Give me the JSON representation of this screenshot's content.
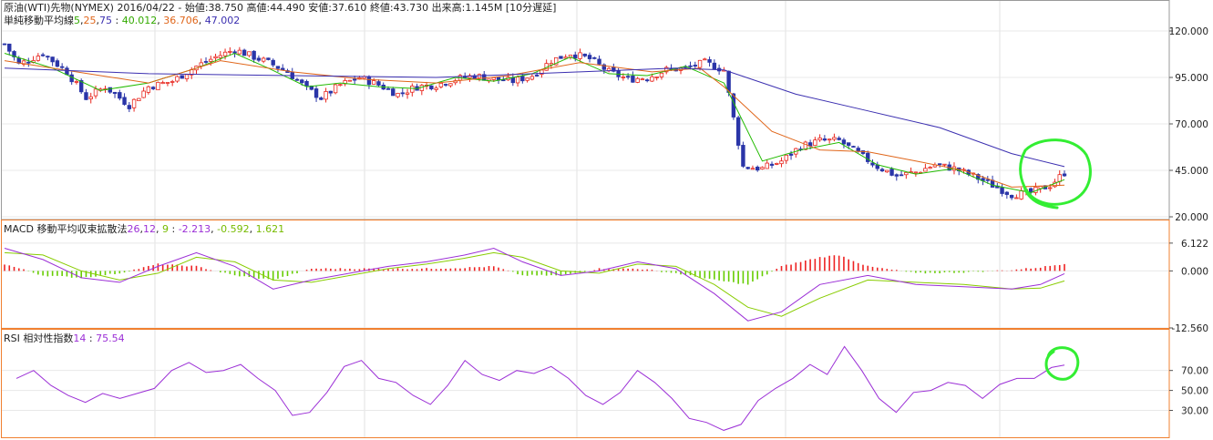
{
  "header": {
    "title": "原油(WTI)先物(NYMEX)",
    "date": "2016/04/22",
    "sep": "-",
    "open": "始値:38.750",
    "high": "高値:44.490",
    "low": "安値:37.610",
    "close": "終値:43.730",
    "volume": "出来高:1.145M",
    "delay": "[10分遅延]"
  },
  "sma_legend": {
    "label": "単純移動平均線",
    "p1": "5",
    "p2": "25",
    "p3": "75",
    "sep": " : ",
    "v1": "40.012",
    "v2": "36.706",
    "v3": "47.002"
  },
  "macd_legend": {
    "label": "MACD 移動平均収束拡散法",
    "p1": "26",
    "p2": "12",
    "p3": "9",
    "sep": " : ",
    "v1": "-2.213",
    "v2": "-0.592",
    "v3": "1.621"
  },
  "rsi_legend": {
    "label": "RSI 相対性指数",
    "period": "14",
    "sep": " : ",
    "value": "75.54"
  },
  "colors": {
    "up": "#e8261e",
    "down": "#2a35a8",
    "sma5": "#22bb00",
    "sma25": "#e0661a",
    "sma75": "#3b2fb0",
    "macd": "#9b2fd6",
    "signal": "#88cc00",
    "hist_pos": "#ee2222",
    "hist_neg": "#66cc00",
    "rsi": "#9b2fd6",
    "annotation": "#33ee33",
    "panel_border": "#f08030"
  },
  "chart_data": [
    {
      "type": "candlestick",
      "name": "price",
      "y_ticks": [
        "120.000",
        "95.000",
        "70.000",
        "45.000",
        "20.000"
      ],
      "ylim": [
        20,
        120
      ],
      "y_tick_values": [
        120,
        95,
        70,
        45,
        20
      ],
      "close_path": [
        [
          0,
          113
        ],
        [
          3,
          102
        ],
        [
          8,
          108
        ],
        [
          13,
          98
        ],
        [
          17,
          84
        ],
        [
          21,
          90
        ],
        [
          26,
          80
        ],
        [
          30,
          90
        ],
        [
          35,
          93
        ],
        [
          40,
          101
        ],
        [
          44,
          106
        ],
        [
          48,
          110
        ],
        [
          52,
          106
        ],
        [
          55,
          103
        ],
        [
          59,
          98
        ],
        [
          63,
          89
        ],
        [
          66,
          84
        ],
        [
          70,
          91
        ],
        [
          74,
          95
        ],
        [
          78,
          91
        ],
        [
          82,
          86
        ],
        [
          86,
          90
        ],
        [
          90,
          91
        ],
        [
          94,
          94
        ],
        [
          98,
          96
        ],
        [
          102,
          94
        ],
        [
          106,
          93
        ],
        [
          110,
          96
        ],
        [
          114,
          104
        ],
        [
          118,
          108
        ],
        [
          122,
          105
        ],
        [
          126,
          98
        ],
        [
          130,
          94
        ],
        [
          134,
          95
        ],
        [
          138,
          99
        ],
        [
          142,
          100
        ],
        [
          146,
          103
        ],
        [
          150,
          99
        ],
        [
          154,
          47
        ],
        [
          158,
          46
        ],
        [
          162,
          50
        ],
        [
          166,
          58
        ],
        [
          170,
          61
        ],
        [
          174,
          61
        ],
        [
          178,
          54
        ],
        [
          182,
          47
        ],
        [
          186,
          42
        ],
        [
          190,
          44
        ],
        [
          194,
          48
        ],
        [
          198,
          46
        ],
        [
          202,
          42
        ],
        [
          206,
          37
        ],
        [
          210,
          32
        ],
        [
          214,
          33
        ],
        [
          218,
          37
        ],
        [
          221,
          43.7
        ]
      ],
      "sma_paths": {
        "sma5": [
          [
            0,
            108
          ],
          [
            10,
            100
          ],
          [
            20,
            88
          ],
          [
            30,
            92
          ],
          [
            40,
            100
          ],
          [
            48,
            108
          ],
          [
            55,
            100
          ],
          [
            63,
            90
          ],
          [
            70,
            92
          ],
          [
            78,
            90
          ],
          [
            86,
            89
          ],
          [
            94,
            95
          ],
          [
            102,
            93
          ],
          [
            110,
            97
          ],
          [
            118,
            106
          ],
          [
            126,
            97
          ],
          [
            134,
            96
          ],
          [
            142,
            101
          ],
          [
            150,
            92
          ],
          [
            158,
            50
          ],
          [
            166,
            56
          ],
          [
            174,
            60
          ],
          [
            182,
            48
          ],
          [
            190,
            43
          ],
          [
            198,
            46
          ],
          [
            206,
            37
          ],
          [
            214,
            33
          ],
          [
            221,
            40
          ]
        ],
        "sma25": [
          [
            0,
            104
          ],
          [
            15,
            98
          ],
          [
            30,
            92
          ],
          [
            45,
            104
          ],
          [
            60,
            98
          ],
          [
            75,
            94
          ],
          [
            90,
            92
          ],
          [
            105,
            96
          ],
          [
            120,
            103
          ],
          [
            135,
            98
          ],
          [
            145,
            100
          ],
          [
            150,
            90
          ],
          [
            160,
            66
          ],
          [
            170,
            56
          ],
          [
            180,
            55
          ],
          [
            190,
            50
          ],
          [
            200,
            45
          ],
          [
            210,
            36
          ],
          [
            221,
            37
          ]
        ],
        "sma75": [
          [
            0,
            100
          ],
          [
            30,
            97
          ],
          [
            60,
            96
          ],
          [
            90,
            95
          ],
          [
            120,
            98
          ],
          [
            140,
            100
          ],
          [
            150,
            99
          ],
          [
            165,
            86
          ],
          [
            180,
            77
          ],
          [
            195,
            68
          ],
          [
            210,
            54
          ],
          [
            221,
            47
          ]
        ]
      }
    },
    {
      "type": "macd",
      "y_ticks": [
        "6.122",
        "0.000",
        "-12.560"
      ],
      "ylim": [
        -12.56,
        7.5
      ],
      "y_tick_values": [
        6.122,
        0,
        -12.56
      ],
      "macd_path": [
        [
          0,
          5
        ],
        [
          8,
          2.5
        ],
        [
          16,
          -1.5
        ],
        [
          24,
          -2.5
        ],
        [
          32,
          1
        ],
        [
          40,
          4
        ],
        [
          48,
          1
        ],
        [
          56,
          -4
        ],
        [
          64,
          -2
        ],
        [
          72,
          -0.5
        ],
        [
          80,
          1
        ],
        [
          88,
          2
        ],
        [
          96,
          3.5
        ],
        [
          102,
          5
        ],
        [
          108,
          2
        ],
        [
          116,
          -1
        ],
        [
          124,
          0
        ],
        [
          132,
          2
        ],
        [
          140,
          0.5
        ],
        [
          148,
          -5
        ],
        [
          155,
          -11
        ],
        [
          162,
          -9
        ],
        [
          170,
          -3
        ],
        [
          180,
          -1
        ],
        [
          190,
          -3
        ],
        [
          200,
          -3.5
        ],
        [
          210,
          -4
        ],
        [
          216,
          -3
        ],
        [
          221,
          -0.6
        ]
      ],
      "signal_path": [
        [
          0,
          4
        ],
        [
          8,
          3.5
        ],
        [
          16,
          0
        ],
        [
          24,
          -2
        ],
        [
          32,
          -0.5
        ],
        [
          40,
          3
        ],
        [
          48,
          2
        ],
        [
          56,
          -2
        ],
        [
          64,
          -2.5
        ],
        [
          72,
          -1
        ],
        [
          80,
          0.5
        ],
        [
          88,
          1.5
        ],
        [
          96,
          2.8
        ],
        [
          102,
          4
        ],
        [
          108,
          3
        ],
        [
          116,
          0
        ],
        [
          124,
          -0.5
        ],
        [
          132,
          1.5
        ],
        [
          140,
          1
        ],
        [
          148,
          -3
        ],
        [
          155,
          -8
        ],
        [
          162,
          -10
        ],
        [
          170,
          -6
        ],
        [
          180,
          -2
        ],
        [
          190,
          -2.5
        ],
        [
          200,
          -3
        ],
        [
          210,
          -4
        ],
        [
          216,
          -3.8
        ],
        [
          221,
          -2.2
        ]
      ],
      "hist_path": [
        [
          0,
          1.5
        ],
        [
          8,
          -1
        ],
        [
          16,
          -1.5
        ],
        [
          24,
          -0.5
        ],
        [
          32,
          1.5
        ],
        [
          40,
          1
        ],
        [
          48,
          -1
        ],
        [
          56,
          -2
        ],
        [
          64,
          0.5
        ],
        [
          72,
          0.5
        ],
        [
          80,
          0.5
        ],
        [
          88,
          0.5
        ],
        [
          96,
          0.7
        ],
        [
          102,
          1
        ],
        [
          108,
          -1
        ],
        [
          116,
          -1
        ],
        [
          124,
          0.5
        ],
        [
          132,
          0.5
        ],
        [
          140,
          -0.5
        ],
        [
          148,
          -2
        ],
        [
          155,
          -3
        ],
        [
          162,
          1
        ],
        [
          170,
          3
        ],
        [
          174,
          3.5
        ],
        [
          180,
          1
        ],
        [
          190,
          -0.5
        ],
        [
          200,
          -0.3
        ],
        [
          210,
          0.2
        ],
        [
          216,
          0.8
        ],
        [
          221,
          1.6
        ]
      ]
    },
    {
      "type": "line",
      "name": "RSI",
      "y_ticks": [
        "70.00",
        "50.00",
        "30.00"
      ],
      "ylim": [
        4,
        98
      ],
      "y_tick_values": [
        70,
        50,
        30
      ],
      "rsi_path": [
        [
          0,
          62
        ],
        [
          4,
          70
        ],
        [
          8,
          55
        ],
        [
          12,
          45
        ],
        [
          16,
          38
        ],
        [
          20,
          47
        ],
        [
          24,
          42
        ],
        [
          28,
          47
        ],
        [
          32,
          52
        ],
        [
          36,
          70
        ],
        [
          40,
          78
        ],
        [
          44,
          68
        ],
        [
          48,
          70
        ],
        [
          52,
          76
        ],
        [
          56,
          62
        ],
        [
          60,
          50
        ],
        [
          64,
          25
        ],
        [
          68,
          28
        ],
        [
          72,
          48
        ],
        [
          76,
          74
        ],
        [
          80,
          80
        ],
        [
          84,
          62
        ],
        [
          88,
          58
        ],
        [
          92,
          45
        ],
        [
          96,
          36
        ],
        [
          100,
          55
        ],
        [
          104,
          80
        ],
        [
          108,
          66
        ],
        [
          112,
          60
        ],
        [
          116,
          70
        ],
        [
          120,
          67
        ],
        [
          124,
          74
        ],
        [
          128,
          62
        ],
        [
          132,
          45
        ],
        [
          136,
          36
        ],
        [
          140,
          48
        ],
        [
          144,
          70
        ],
        [
          148,
          58
        ],
        [
          152,
          42
        ],
        [
          156,
          22
        ],
        [
          160,
          18
        ],
        [
          164,
          10
        ],
        [
          168,
          16
        ],
        [
          172,
          40
        ],
        [
          176,
          52
        ],
        [
          180,
          62
        ],
        [
          184,
          76
        ],
        [
          188,
          66
        ],
        [
          192,
          94
        ],
        [
          196,
          70
        ],
        [
          200,
          42
        ],
        [
          204,
          28
        ],
        [
          208,
          48
        ],
        [
          212,
          50
        ],
        [
          216,
          58
        ],
        [
          220,
          55
        ],
        [
          224,
          42
        ],
        [
          228,
          56
        ],
        [
          232,
          62
        ],
        [
          236,
          62
        ],
        [
          240,
          73
        ],
        [
          243,
          75.5
        ]
      ]
    }
  ]
}
